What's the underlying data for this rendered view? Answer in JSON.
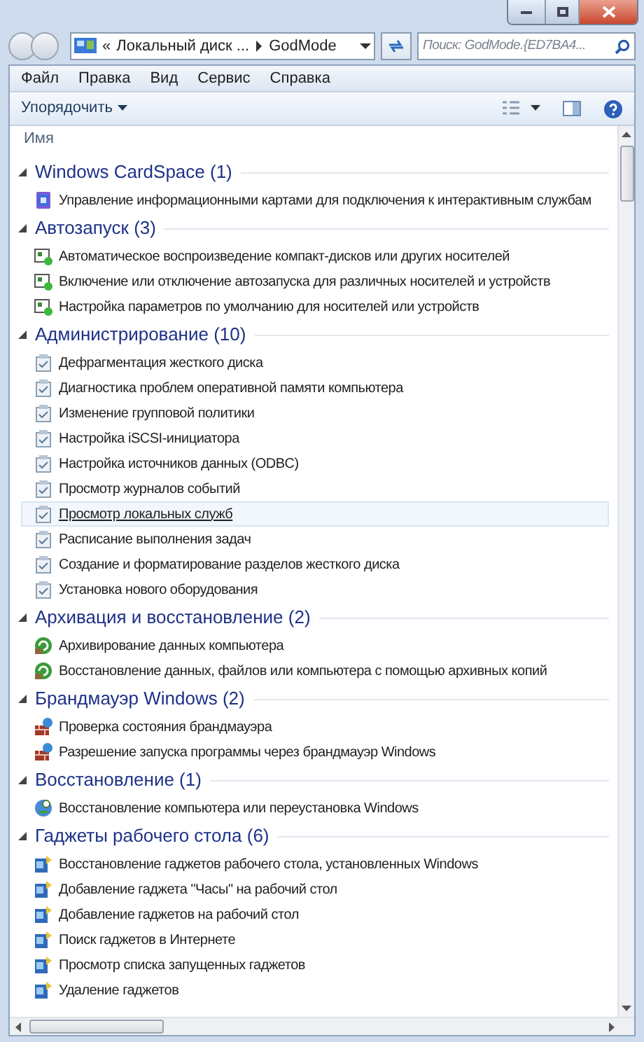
{
  "address": {
    "overflow": "«",
    "segments": [
      "Локальный диск ...",
      "GodMode"
    ]
  },
  "search": {
    "placeholder": "Поиск: GodMode.{ED7BA4..."
  },
  "menu": [
    "Файл",
    "Правка",
    "Вид",
    "Сервис",
    "Справка"
  ],
  "toolbar": {
    "organize": "Упорядочить"
  },
  "column_header": "Имя",
  "groups": [
    {
      "title": "Windows CardSpace (1)",
      "kind": "cardspace",
      "expanded": true,
      "items": [
        {
          "label": "Управление информационными картами для подключения к интерактивным службам",
          "selected": false
        }
      ]
    },
    {
      "title": "Автозапуск (3)",
      "kind": "autoplay",
      "expanded": true,
      "items": [
        {
          "label": "Автоматическое воспроизведение компакт-дисков или других носителей",
          "selected": false
        },
        {
          "label": "Включение или отключение автозапуска для различных носителей и устройств",
          "selected": false
        },
        {
          "label": "Настройка параметров по умолчанию для носителей или устройств",
          "selected": false
        }
      ]
    },
    {
      "title": "Администрирование (10)",
      "kind": "admin",
      "expanded": true,
      "items": [
        {
          "label": "Дефрагментация жесткого диска",
          "selected": false
        },
        {
          "label": "Диагностика проблем оперативной памяти компьютера",
          "selected": false
        },
        {
          "label": "Изменение групповой политики",
          "selected": false
        },
        {
          "label": "Настройка iSCSI-инициатора",
          "selected": false
        },
        {
          "label": "Настройка источников данных (ODBC)",
          "selected": false
        },
        {
          "label": "Просмотр журналов событий",
          "selected": false
        },
        {
          "label": "Просмотр локальных служб",
          "selected": true
        },
        {
          "label": "Расписание выполнения задач",
          "selected": false
        },
        {
          "label": "Создание и форматирование разделов жесткого диска",
          "selected": false
        },
        {
          "label": "Установка нового оборудования",
          "selected": false
        }
      ]
    },
    {
      "title": "Архивация и восстановление (2)",
      "kind": "backup",
      "expanded": true,
      "items": [
        {
          "label": "Архивирование данных компьютера",
          "selected": false
        },
        {
          "label": "Восстановление данных, файлов или компьютера с помощью архивных копий",
          "selected": false
        }
      ]
    },
    {
      "title": "Брандмауэр Windows (2)",
      "kind": "firewall",
      "expanded": true,
      "items": [
        {
          "label": "Проверка состояния брандмауэра",
          "selected": false
        },
        {
          "label": "Разрешение запуска программы через брандмауэр Windows",
          "selected": false
        }
      ]
    },
    {
      "title": "Восстановление (1)",
      "kind": "recovery",
      "expanded": true,
      "items": [
        {
          "label": "Восстановление компьютера или переустановка Windows",
          "selected": false
        }
      ]
    },
    {
      "title": "Гаджеты рабочего стола (6)",
      "kind": "gadget",
      "expanded": true,
      "items": [
        {
          "label": "Восстановление гаджетов рабочего стола, установленных Windows",
          "selected": false
        },
        {
          "label": "Добавление гаджета \"Часы\" на рабочий стол",
          "selected": false
        },
        {
          "label": "Добавление гаджетов на рабочий стол",
          "selected": false
        },
        {
          "label": "Поиск гаджетов в Интернете",
          "selected": false
        },
        {
          "label": "Просмотр списка запущенных гаджетов",
          "selected": false
        },
        {
          "label": "Удаление гаджетов",
          "selected": false
        }
      ]
    }
  ]
}
